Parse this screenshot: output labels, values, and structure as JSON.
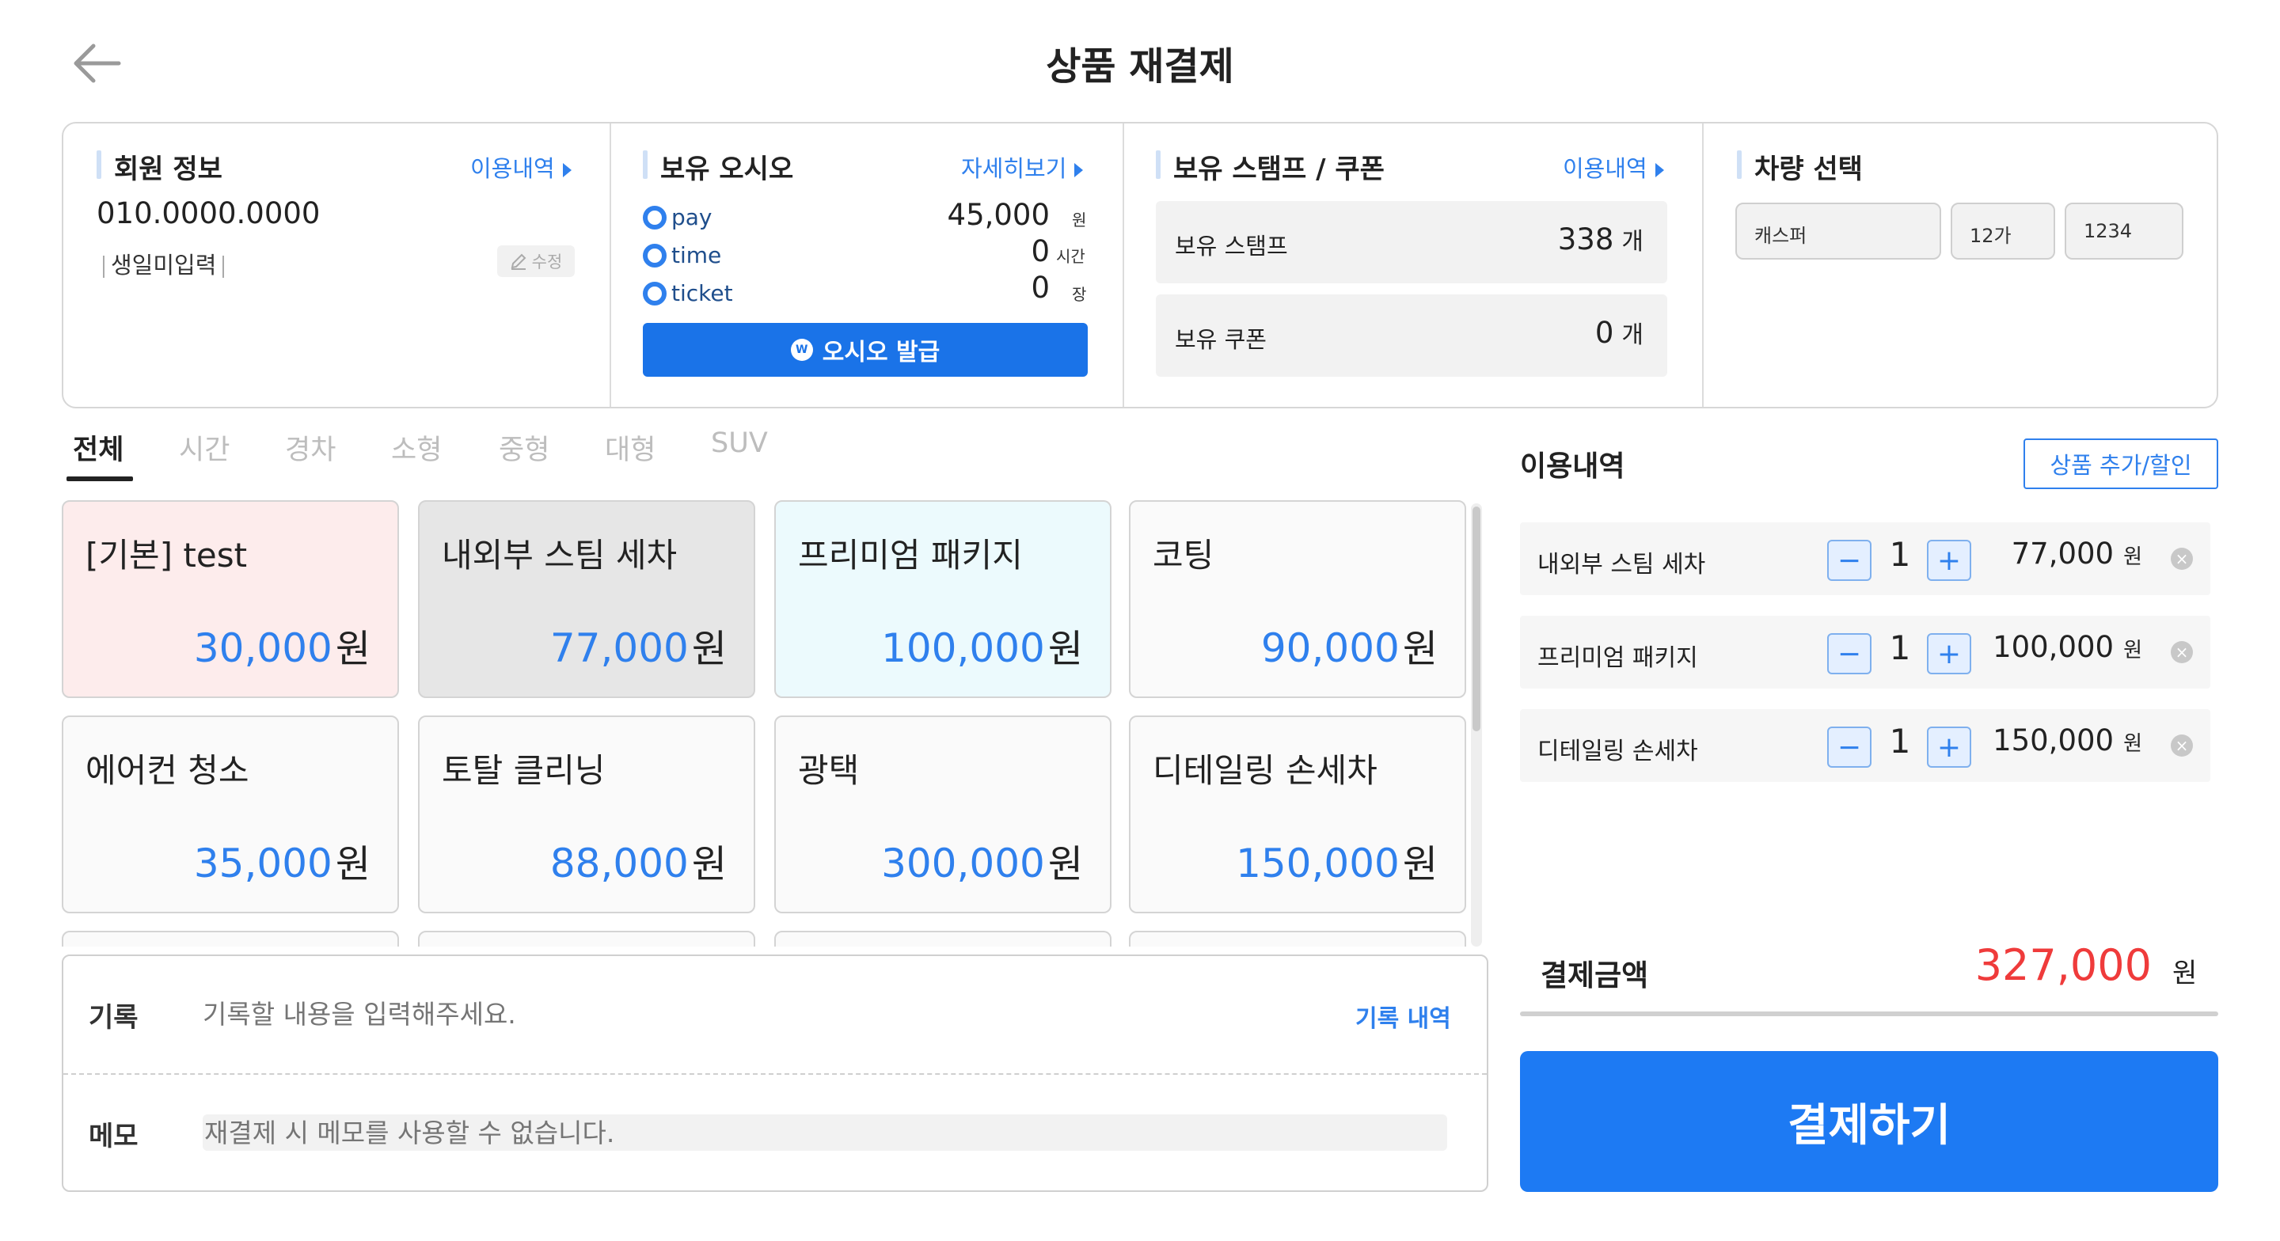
{
  "header": {
    "title": "상품 재결제"
  },
  "member": {
    "title": "회원 정보",
    "link": "이용내역",
    "phone": "010.0000.0000",
    "birthday": "생일미입력",
    "edit": "수정"
  },
  "oasis": {
    "title": "보유 오시오",
    "link": "자세히보기",
    "items": [
      {
        "label": "pay",
        "value": "45,000",
        "unit": "원"
      },
      {
        "label": "time",
        "value": "0",
        "unit": "시간"
      },
      {
        "label": "ticket",
        "value": "0",
        "unit": "장"
      }
    ],
    "issue_button": "오시오 발급",
    "coin": "W"
  },
  "stamps": {
    "title": "보유 스탬프 / 쿠폰",
    "link": "이용내역",
    "stamp_label": "보유 스탬프",
    "stamp_value": "338",
    "stamp_unit": "개",
    "coupon_label": "보유 쿠폰",
    "coupon_value": "0",
    "coupon_unit": "개"
  },
  "vehicle": {
    "title": "차량 선택",
    "model": "캐스퍼",
    "plate_prefix": "12가",
    "plate_number": "1234"
  },
  "tabs": [
    "전체",
    "시간",
    "경차",
    "소형",
    "중형",
    "대형",
    "SUV"
  ],
  "products": [
    {
      "name": "[기본] test",
      "price": "30,000",
      "unit": "원",
      "bg": "#fdecec"
    },
    {
      "name": "내외부 스팀 세차",
      "price": "77,000",
      "unit": "원",
      "bg": "#e6e6e6"
    },
    {
      "name": "프리미엄 패키지",
      "price": "100,000",
      "unit": "원",
      "bg": "#ecfafd"
    },
    {
      "name": "코팅",
      "price": "90,000",
      "unit": "원",
      "bg": "#fafafa"
    },
    {
      "name": "에어컨 청소",
      "price": "35,000",
      "unit": "원",
      "bg": "#fafafa"
    },
    {
      "name": "토탈 클리닝",
      "price": "88,000",
      "unit": "원",
      "bg": "#fafafa"
    },
    {
      "name": "광택",
      "price": "300,000",
      "unit": "원",
      "bg": "#fafafa"
    },
    {
      "name": "디테일링 손세차",
      "price": "150,000",
      "unit": "원",
      "bg": "#fafafa"
    }
  ],
  "memo": {
    "record_label": "기록",
    "record_placeholder": "기록할 내용을 입력해주세요.",
    "record_history": "기록 내역",
    "memo_label": "메모",
    "memo_placeholder": "재결제 시 메모를 사용할 수 없습니다."
  },
  "usage": {
    "title": "이용내역",
    "add_button": "상품 추가/할인",
    "items": [
      {
        "name": "내외부 스팀 세차",
        "qty": "1",
        "price": "77,000",
        "unit": "원"
      },
      {
        "name": "프리미엄 패키지",
        "qty": "1",
        "price": "100,000",
        "unit": "원"
      },
      {
        "name": "디테일링 손세차",
        "qty": "1",
        "price": "150,000",
        "unit": "원"
      }
    ],
    "minus": "−",
    "plus": "+",
    "remove": "×"
  },
  "total": {
    "label": "결제금액",
    "value": "327,000",
    "unit": "원"
  },
  "pay_button": "결제하기",
  "colors": {
    "accent": "#1d7af3",
    "total": "#ef3b3b",
    "link": "#2f80ed"
  }
}
